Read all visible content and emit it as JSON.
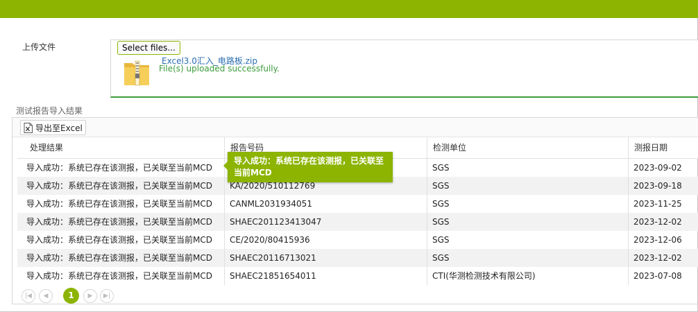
{
  "colors": {
    "accent": "#8cb400",
    "success": "#3c9b3c",
    "link": "#2a6db0"
  },
  "upload": {
    "label": "上传文件",
    "select_button": "Select files...",
    "file_name": "Excel3.0汇入_电路板.zip",
    "status": "File(s) uploaded successfully.",
    "file_icon": "zip-folder-icon"
  },
  "results": {
    "title": "测试报告导入结果",
    "export_label": "导出至Excel",
    "export_icon": "excel-icon",
    "columns": [
      "处理结果",
      "报告号码",
      "检测单位",
      "测报日期"
    ],
    "rows": [
      [
        "导入成功：系统已存在该测报，已关联至当前MCD",
        "",
        "SGS",
        "2023-09-02"
      ],
      [
        "导入成功：系统已存在该测报，已关联至当前MCD",
        "KA/2020/510112769",
        "SGS",
        "2023-09-18"
      ],
      [
        "导入成功：系统已存在该测报，已关联至当前MCD",
        "CANML2031934051",
        "SGS",
        "2023-11-25"
      ],
      [
        "导入成功：系统已存在该测报，已关联至当前MCD",
        "SHAEC201123413047",
        "SGS",
        "2023-12-02"
      ],
      [
        "导入成功：系统已存在该测报，已关联至当前MCD",
        "CE/2020/80415936",
        "SGS",
        "2023-12-06"
      ],
      [
        "导入成功：系统已存在该测报，已关联至当前MCD",
        "SHAEC20116713021",
        "SGS",
        "2023-12-02"
      ],
      [
        "导入成功：系统已存在该测报，已关联至当前MCD",
        "SHAEC21851654011",
        "CTI(华测检测技术有限公司)",
        "2023-07-08"
      ]
    ],
    "tooltip": "导入成功：系统已存在该测报，已关联至当前MCD",
    "pager": {
      "current_page": "1",
      "first_icon": "first-page-icon",
      "prev_icon": "prev-page-icon",
      "next_icon": "next-page-icon",
      "last_icon": "last-page-icon"
    }
  }
}
